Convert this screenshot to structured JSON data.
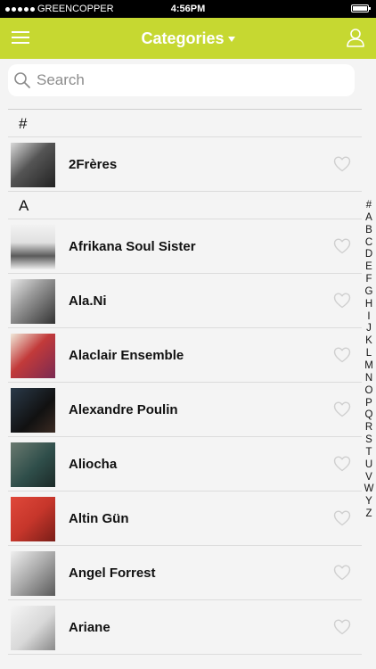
{
  "status_bar": {
    "carrier": "GREENCOPPER",
    "time": "4:56PM"
  },
  "nav": {
    "title": "Categories"
  },
  "search": {
    "placeholder": "Search"
  },
  "sections": [
    {
      "header": "#",
      "items": [
        {
          "name": "2Frères"
        }
      ]
    },
    {
      "header": "A",
      "items": [
        {
          "name": "Afrikana Soul Sister"
        },
        {
          "name": "Ala.Ni"
        },
        {
          "name": "Alaclair Ensemble"
        },
        {
          "name": "Alexandre Poulin"
        },
        {
          "name": "Aliocha"
        },
        {
          "name": "Altin Gün"
        },
        {
          "name": "Angel Forrest"
        },
        {
          "name": "Ariane"
        }
      ]
    }
  ],
  "index_letters": [
    "#",
    "A",
    "B",
    "C",
    "D",
    "E",
    "F",
    "G",
    "H",
    "I",
    "J",
    "K",
    "L",
    "M",
    "N",
    "O",
    "P",
    "Q",
    "R",
    "S",
    "T",
    "U",
    "V",
    "W",
    "Y",
    "Z"
  ],
  "colors": {
    "accent": "#c6d831",
    "background": "#f4f4f4"
  }
}
